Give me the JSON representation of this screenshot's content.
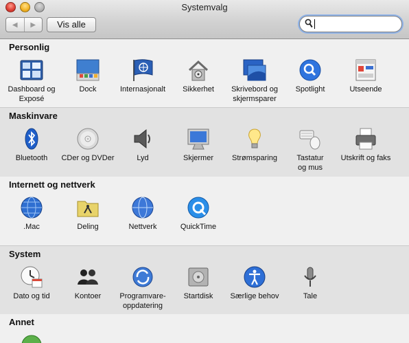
{
  "window": {
    "title": "Systemvalg",
    "back_label": "◀",
    "forward_label": "▶",
    "show_all_label": "Vis alle",
    "search_value": ""
  },
  "sections": [
    {
      "title": "Personlig",
      "items": [
        {
          "label": "Dashboard og\nExposé",
          "icon": "dashboard-expose-icon"
        },
        {
          "label": "Dock",
          "icon": "dock-icon"
        },
        {
          "label": "Internasjonalt",
          "icon": "international-flag-icon"
        },
        {
          "label": "Sikkerhet",
          "icon": "security-house-icon"
        },
        {
          "label": "Skrivebord og\nskjermsparer",
          "icon": "desktop-screensaver-icon"
        },
        {
          "label": "Spotlight",
          "icon": "spotlight-icon"
        },
        {
          "label": "Utseende",
          "icon": "appearance-icon"
        }
      ]
    },
    {
      "title": "Maskinvare",
      "items": [
        {
          "label": "Bluetooth",
          "icon": "bluetooth-icon"
        },
        {
          "label": "CDer og DVDer",
          "icon": "cd-dvd-icon"
        },
        {
          "label": "Lyd",
          "icon": "speaker-icon"
        },
        {
          "label": "Skjermer",
          "icon": "display-icon"
        },
        {
          "label": "Strømsparing",
          "icon": "lightbulb-icon"
        },
        {
          "label": "Tastatur\nog mus",
          "icon": "keyboard-mouse-icon"
        },
        {
          "label": "Utskrift og faks",
          "icon": "printer-icon"
        }
      ]
    },
    {
      "title": "Internett og nettverk",
      "items": [
        {
          "label": ".Mac",
          "icon": "dotmac-globe-icon"
        },
        {
          "label": "Deling",
          "icon": "sharing-folder-icon"
        },
        {
          "label": "Nettverk",
          "icon": "network-globe-icon"
        },
        {
          "label": "QuickTime",
          "icon": "quicktime-icon"
        }
      ]
    },
    {
      "title": "System",
      "items": [
        {
          "label": "Dato og tid",
          "icon": "date-time-icon"
        },
        {
          "label": "Kontoer",
          "icon": "accounts-icon"
        },
        {
          "label": "Programvare-\noppdatering",
          "icon": "software-update-icon"
        },
        {
          "label": "Startdisk",
          "icon": "startup-disk-icon"
        },
        {
          "label": "Særlige behov",
          "icon": "universal-access-icon"
        },
        {
          "label": "Tale",
          "icon": "speech-microphone-icon"
        }
      ]
    },
    {
      "title": "Annet",
      "items": []
    }
  ]
}
